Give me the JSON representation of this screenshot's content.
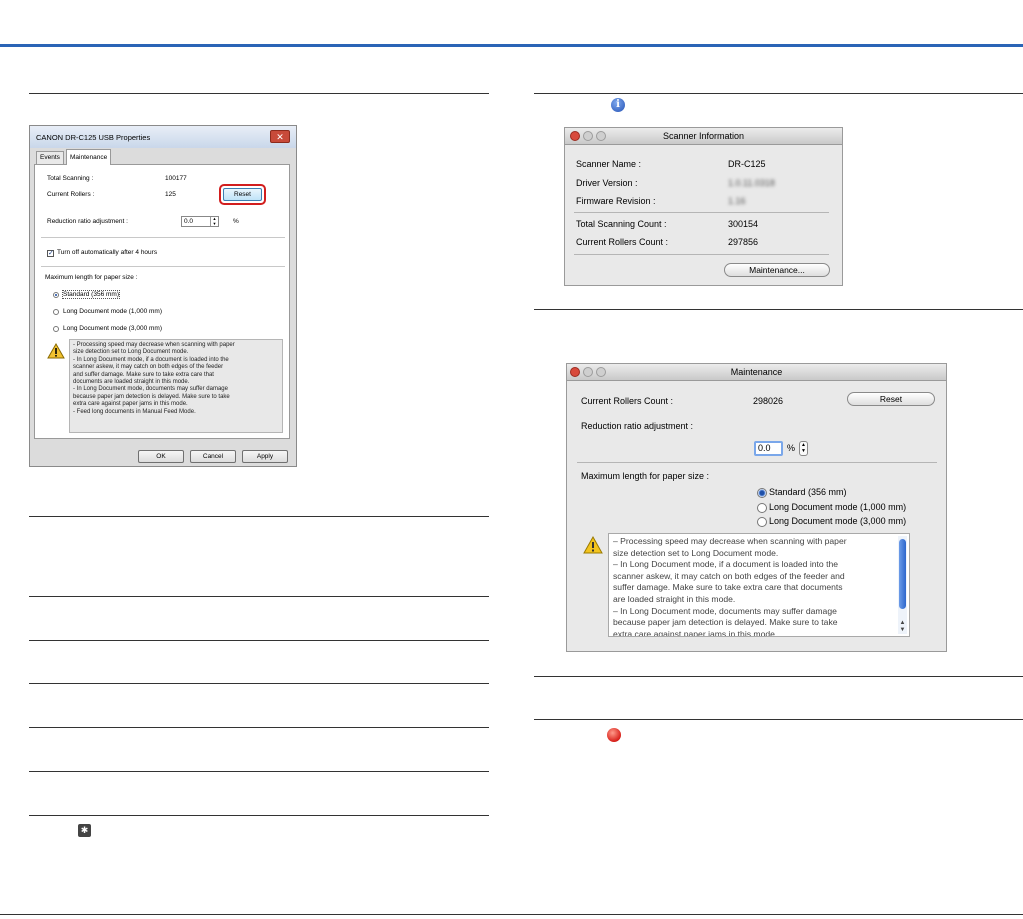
{
  "windows_dialog": {
    "title": "CANON DR-C125 USB Properties",
    "close_glyph": "✕",
    "tabs": [
      "Events",
      "Maintenance"
    ],
    "total_scanning_label": "Total Scanning :",
    "total_scanning_value": "100177",
    "current_rollers_label": "Current Rollers :",
    "current_rollers_value": "125",
    "reset_label": "Reset",
    "reduction_label": "Reduction ratio adjustment :",
    "reduction_value": "0.0",
    "reduction_unit": "%",
    "auto_off_label": "Turn off automatically after 4 hours",
    "auto_off_checked": true,
    "max_length_label": "Maximum length for paper size :",
    "radio_options": [
      "Standard (356 mm)",
      "Long Document mode (1,000 mm)",
      "Long Document mode (3,000 mm)"
    ],
    "selected_option": 0,
    "note_lines": [
      "- Processing speed may decrease when scanning with paper",
      "size detection set to Long Document mode.",
      "- In Long Document mode, if a document is loaded into the",
      "scanner askew, it may catch on both edges of the feeder",
      "and suffer damage. Make sure to take extra care that",
      "documents are loaded straight in this mode.",
      "- In Long Document mode, documents may suffer damage",
      "because paper jam detection is delayed. Make sure to take",
      "extra care against paper jams in this mode.",
      "- Feed long documents in Manual Feed Mode."
    ],
    "ok_label": "OK",
    "cancel_label": "Cancel",
    "apply_label": "Apply"
  },
  "scanner_info": {
    "title": "Scanner Information",
    "scanner_name_label": "Scanner Name :",
    "scanner_name_value": "DR-C125",
    "driver_version_label": "Driver Version :",
    "driver_version_value": "1.0.11.0318",
    "firmware_revision_label": "Firmware Revision :",
    "firmware_revision_value": "1.16",
    "total_scanning_count_label": "Total Scanning Count :",
    "total_scanning_count_value": "300154",
    "current_rollers_count_label": "Current Rollers Count :",
    "current_rollers_count_value": "297856",
    "maintenance_button": "Maintenance..."
  },
  "maintenance_window": {
    "title": "Maintenance",
    "current_rollers_count_label": "Current Rollers Count :",
    "current_rollers_count_value": "298026",
    "reset_label": "Reset",
    "reduction_label": "Reduction ratio adjustment :",
    "reduction_value": "0.0",
    "reduction_unit": "%",
    "max_length_label": "Maximum length for paper size :",
    "radio_options": [
      "Standard (356 mm)",
      "Long Document mode (1,000 mm)",
      "Long Document mode (3,000 mm)"
    ],
    "selected_option": 0,
    "note_lines": [
      "– Processing speed may decrease when scanning with paper",
      "size detection set to Long Document mode.",
      "– In Long Document mode, if a document is loaded into the",
      "scanner askew, it may catch on both edges of the feeder and",
      "suffer damage. Make sure to take extra care that documents",
      "are loaded straight in this mode.",
      "– In Long Document mode, documents may suffer damage",
      "because paper jam detection is delayed. Make sure to take",
      "extra care against paper jams in this mode."
    ]
  },
  "icons": {
    "info": "info-icon",
    "stop": "stop-icon",
    "gear": "gear-icon",
    "warning": "warning-icon"
  },
  "colors": {
    "header_bar": "#2a64b6",
    "reset_highlight": "#d21e1e",
    "mac_close": "#d84a3c"
  }
}
